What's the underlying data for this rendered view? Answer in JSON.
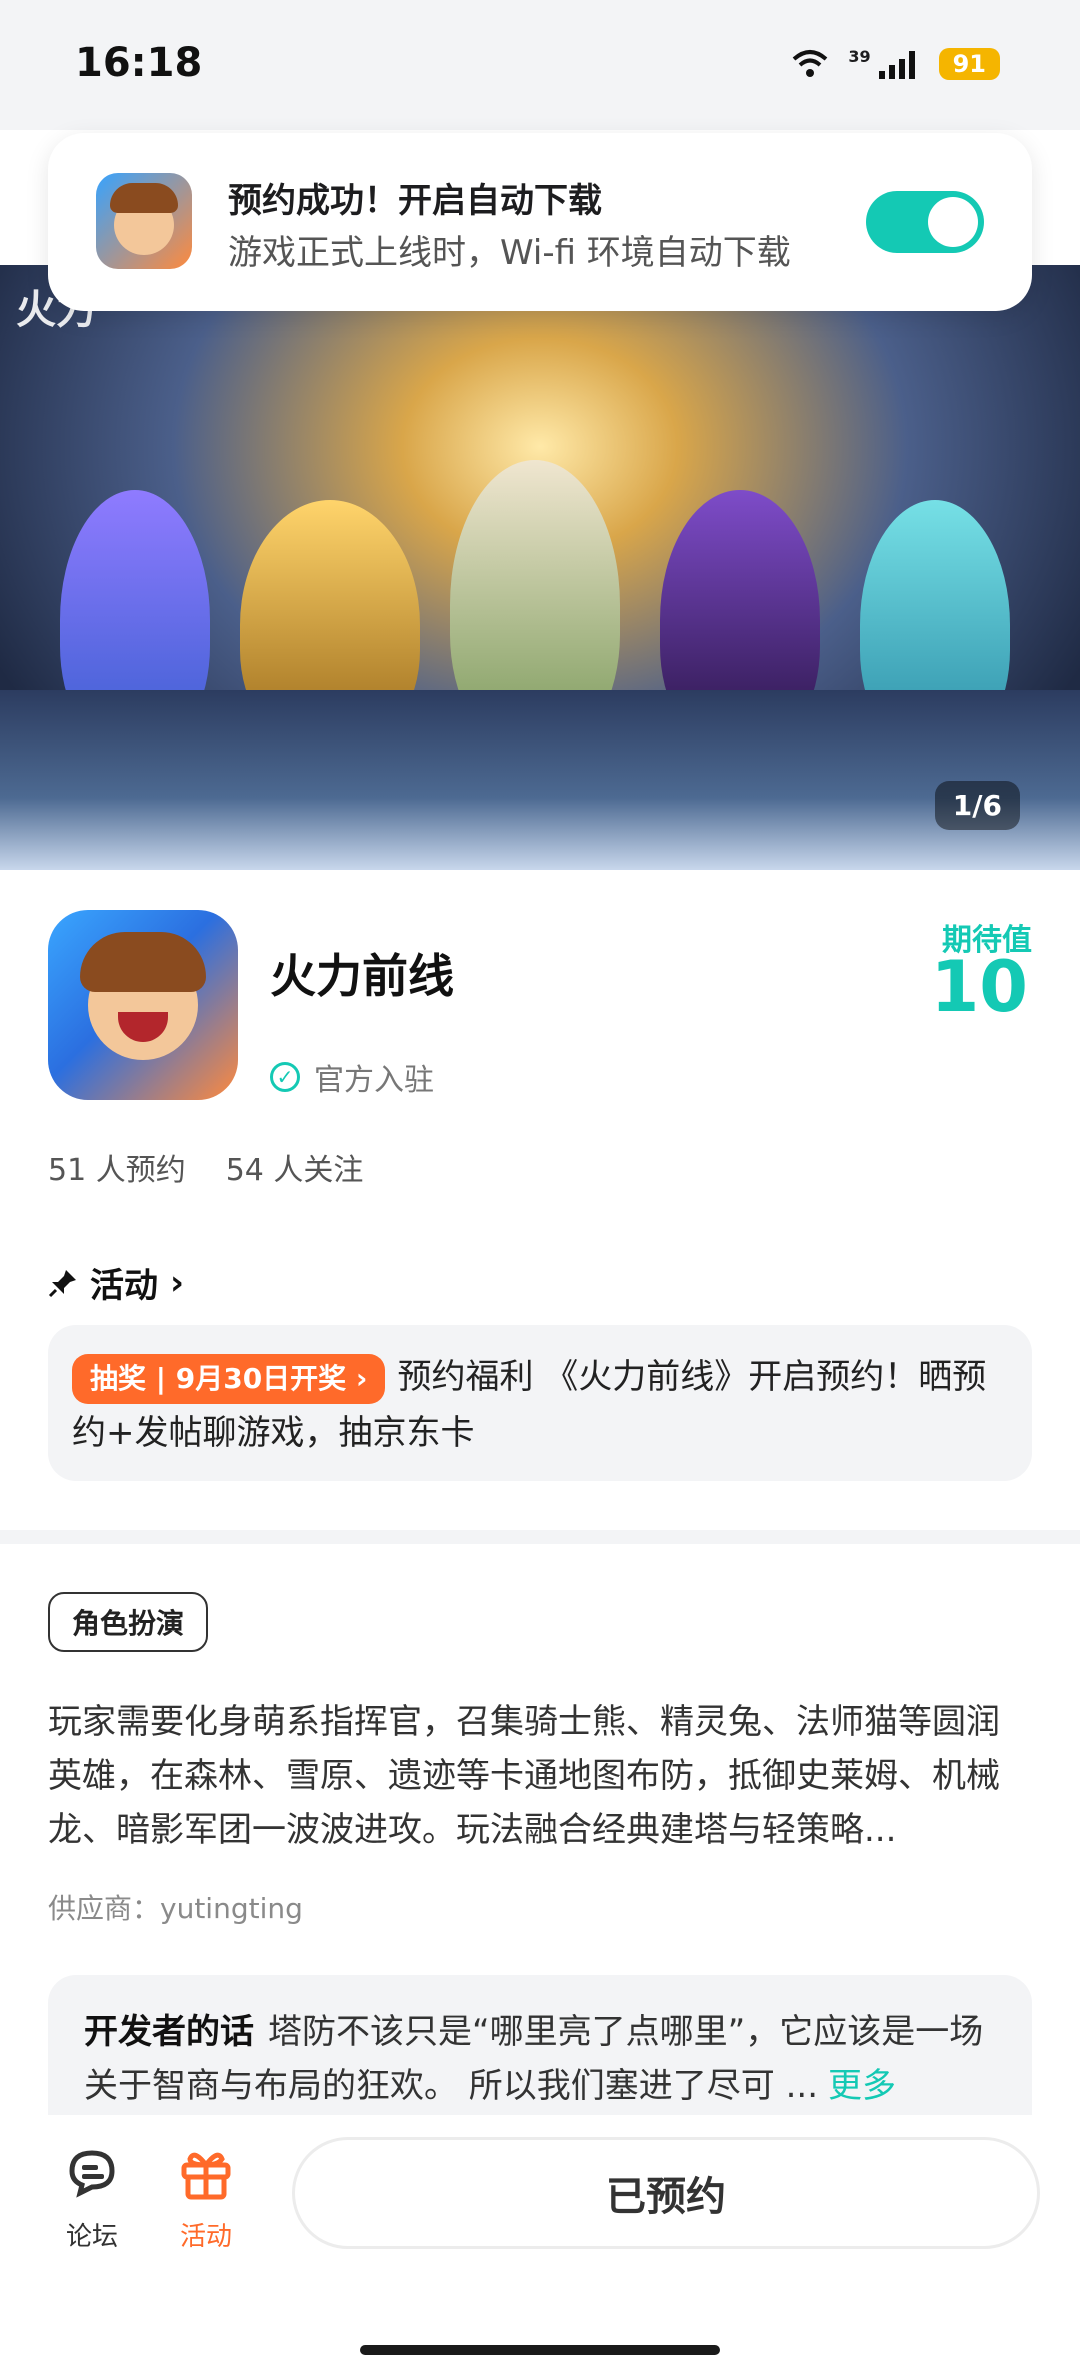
{
  "status_bar": {
    "time": "16:18",
    "network": "39",
    "battery": "91"
  },
  "toast": {
    "title": "预约成功！开启自动下载",
    "subtitle": "游戏正式上线时，Wi-fi 环境自动下载",
    "toggle_on": true
  },
  "hero": {
    "counter": "1/6",
    "logo_text": "火力"
  },
  "game": {
    "title": "火力前线",
    "verified": "官方入驻",
    "expect_label": "期待值",
    "expect_value": "10",
    "reservations": "51 人预约",
    "followers": "54 人关注"
  },
  "activity": {
    "heading": "活动",
    "pill": "抽奖 | 9月30日开奖",
    "text": "预约福利 《火力前线》开启预约！晒预约+发帖聊游戏，抽京东卡"
  },
  "details": {
    "tag": "角色扮演",
    "description": "玩家需要化身萌系指挥官，召集骑士熊、精灵兔、法师猫等圆润英雄，在森林、雪原、遗迹等卡通地图布防，抵御史莱姆、机械龙、暗影军团一波波进攻。玩法融合经典建塔与轻策略...",
    "supplier": "供应商：yutingting"
  },
  "developer": {
    "label": "开发者的话",
    "text": "塔防不该只是“哪里亮了点哪里”，它应该是一场关于智商与布局的狂欢。 所以我们塞进了尽可 ...",
    "more": "更多"
  },
  "bottom_nav": {
    "forum": "论坛",
    "activity": "活动",
    "primary": "已预约"
  },
  "colors": {
    "accent": "#14c9b4",
    "orange": "#ff6a2a"
  }
}
